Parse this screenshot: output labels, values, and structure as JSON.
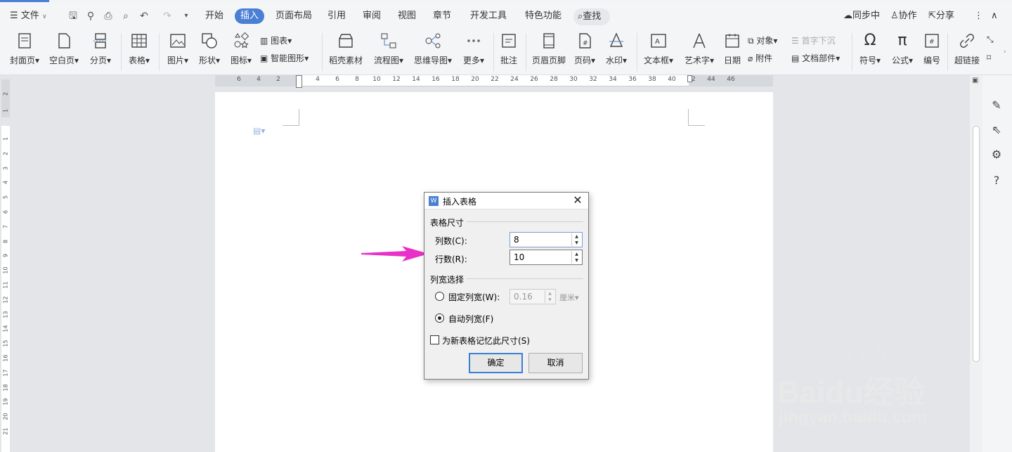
{
  "menubar": {
    "file_label": "文件",
    "tabs": [
      "开始",
      "插入",
      "页面布局",
      "引用",
      "审阅",
      "视图",
      "章节",
      "开发工具",
      "特色功能"
    ],
    "active_tab": "插入",
    "search_label": "查找",
    "sync_label": "同步中",
    "collab_label": "协作",
    "share_label": "分享"
  },
  "ribbon": {
    "cover_page": "封面页",
    "blank_page": "空白页",
    "page_break": "分页",
    "table": "表格",
    "picture": "图片",
    "shape": "形状",
    "icon": "图标",
    "chart": "图表",
    "smart_graphic": "智能图形",
    "daoke_material": "稻壳素材",
    "flowchart": "流程图",
    "mindmap": "思维导图",
    "more": "更多",
    "comment": "批注",
    "header_footer": "页眉页脚",
    "page_number": "页码",
    "watermark": "水印",
    "textbox": "文本框",
    "wordart": "艺术字",
    "date": "日期",
    "object": "对象",
    "attachment": "附件",
    "drop_cap": "首字下沉",
    "doc_parts": "文档部件",
    "symbol": "符号",
    "formula": "公式",
    "numbering": "编号",
    "hyperlink": "超链接"
  },
  "ruler": {
    "numbers": [
      "6",
      "4",
      "2",
      "2",
      "4",
      "6",
      "8",
      "10",
      "12",
      "14",
      "16",
      "18",
      "20",
      "22",
      "24",
      "26",
      "28",
      "30",
      "32",
      "34",
      "36",
      "38",
      "40",
      "42",
      "44",
      "46"
    ],
    "vnumbers": [
      "2",
      "1",
      "1",
      "2",
      "3",
      "4",
      "5",
      "6",
      "7",
      "8",
      "9",
      "10",
      "11",
      "12",
      "13",
      "14",
      "15",
      "16",
      "17",
      "18",
      "19",
      "20",
      "21"
    ]
  },
  "dialog": {
    "title": "插入表格",
    "size_group": "表格尺寸",
    "columns_label": "列数(C):",
    "columns_value": "8",
    "rows_label": "行数(R):",
    "rows_value": "10",
    "width_group": "列宽选择",
    "fixed_width_label": "固定列宽(W):",
    "fixed_width_value": "0.16",
    "unit_label": "厘米",
    "auto_width_label": "自动列宽(F)",
    "remember_label": "为新表格记忆此尺寸(S)",
    "ok_label": "确定",
    "cancel_label": "取消"
  },
  "watermark": {
    "brand": "Baidu经验",
    "url": "jingyan.baidu.com"
  },
  "colors": {
    "accent": "#4a7fd4",
    "arrow": "#e930c8"
  }
}
